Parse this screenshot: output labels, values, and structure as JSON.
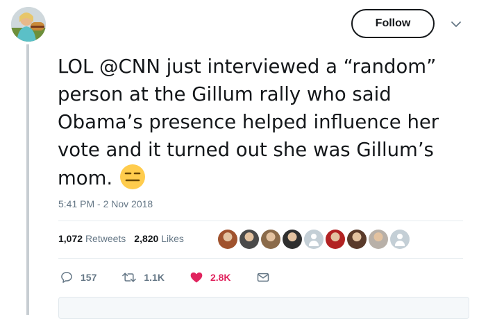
{
  "header": {
    "follow_label": "Follow"
  },
  "tweet": {
    "text_lines": [
      "LOL @CNN just interviewed a “random”",
      "person at the Gillum rally who said",
      "Obama’s presence helped influence her",
      "vote and it turned out she was Gillum’s",
      "mom."
    ],
    "emoji": "expressionless-face",
    "timestamp": "5:41 PM - 2 Nov 2018"
  },
  "stats": {
    "retweets_count": "1,072",
    "retweets_label": "Retweets",
    "likes_count": "2,820",
    "likes_label": "Likes"
  },
  "likers": [
    {
      "kind": "photo",
      "color": "#a0522d"
    },
    {
      "kind": "photo",
      "color": "#4a4a4a"
    },
    {
      "kind": "photo",
      "color": "#8b6b4a"
    },
    {
      "kind": "photo",
      "color": "#2f2f2f"
    },
    {
      "kind": "default",
      "color": "#c4cfd6"
    },
    {
      "kind": "photo",
      "color": "#b22222"
    },
    {
      "kind": "photo",
      "color": "#5a3a2a"
    },
    {
      "kind": "photo",
      "color": "#b8b0a8"
    },
    {
      "kind": "default",
      "color": "#c4cfd6"
    }
  ],
  "actions": {
    "reply_count": "157",
    "retweet_count": "1.1K",
    "like_count": "2.8K"
  },
  "colors": {
    "text": "#14171a",
    "secondary": "#657786",
    "like": "#e0245e",
    "divider": "#e6ecf0"
  }
}
